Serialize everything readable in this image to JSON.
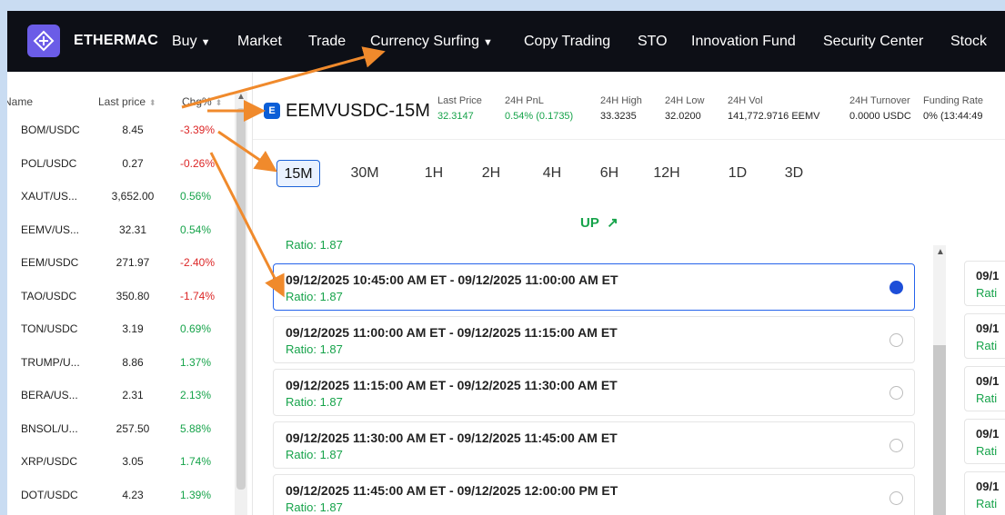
{
  "nav": {
    "brand": "ETHERMAC",
    "items": [
      "Buy",
      "Market",
      "Trade",
      "Currency Surfing",
      "Copy Trading",
      "STO",
      "Innovation Fund",
      "Security Center",
      "Stock"
    ]
  },
  "market": {
    "headers": {
      "name": "Name",
      "last_price": "Last price",
      "change": "Chg%"
    },
    "rows": [
      {
        "name": "BOM/USDC",
        "price": "8.45",
        "chg": "-3.39%"
      },
      {
        "name": "POL/USDC",
        "price": "0.27",
        "chg": "-0.26%"
      },
      {
        "name": "XAUT/US...",
        "price": "3,652.00",
        "chg": "0.56%"
      },
      {
        "name": "EEMV/US...",
        "price": "32.31",
        "chg": "0.54%"
      },
      {
        "name": "EEM/USDC",
        "price": "271.97",
        "chg": "-2.40%"
      },
      {
        "name": "TAO/USDC",
        "price": "350.80",
        "chg": "-1.74%"
      },
      {
        "name": "TON/USDC",
        "price": "3.19",
        "chg": "0.69%"
      },
      {
        "name": "TRUMP/U...",
        "price": "8.86",
        "chg": "1.37%"
      },
      {
        "name": "BERA/US...",
        "price": "2.31",
        "chg": "2.13%"
      },
      {
        "name": "BNSOL/U...",
        "price": "257.50",
        "chg": "5.88%"
      },
      {
        "name": "XRP/USDC",
        "price": "3.05",
        "chg": "1.74%"
      },
      {
        "name": "DOT/USDC",
        "price": "4.23",
        "chg": "1.39%"
      }
    ]
  },
  "ticker": {
    "icon_letter": "E",
    "symbol": "EEMVUSDC-15M",
    "stats": [
      {
        "label": "Last Price",
        "value": "32.3147",
        "green": true
      },
      {
        "label": "24H PnL",
        "value": "0.54% (0.1735)",
        "green": true
      },
      {
        "label": "24H High",
        "value": "33.3235",
        "green": false
      },
      {
        "label": "24H Low",
        "value": "32.0200",
        "green": false
      },
      {
        "label": "24H Vol",
        "value": "141,772.9716 EEMV",
        "green": false
      },
      {
        "label": "24H Turnover",
        "value": "0.0000 USDC",
        "green": false
      },
      {
        "label": "Funding Rate",
        "value": "0% (13:44:49",
        "green": false
      }
    ]
  },
  "intervals": {
    "items": [
      "15M",
      "30M",
      "1H",
      "2H",
      "4H",
      "6H",
      "12H",
      "1D",
      "3D"
    ],
    "active": "15M"
  },
  "options": {
    "direction_label": "UP",
    "direction_icon": "arrow-up-right-icon",
    "cut_ratio": "Ratio: 1.87",
    "cards": [
      {
        "time": "09/12/2025 10:45:00 AM ET - 09/12/2025 11:00:00 AM ET",
        "ratio": "Ratio: 1.87",
        "selected": true
      },
      {
        "time": "09/12/2025 11:00:00 AM ET - 09/12/2025 11:15:00 AM ET",
        "ratio": "Ratio: 1.87",
        "selected": false
      },
      {
        "time": "09/12/2025 11:15:00 AM ET - 09/12/2025 11:30:00 AM ET",
        "ratio": "Ratio: 1.87",
        "selected": false
      },
      {
        "time": "09/12/2025 11:30:00 AM ET - 09/12/2025 11:45:00 AM ET",
        "ratio": "Ratio: 1.87",
        "selected": false
      },
      {
        "time": "09/12/2025 11:45:00 AM ET - 09/12/2025 12:00:00 PM ET",
        "ratio": "Ratio: 1.87",
        "selected": false
      }
    ]
  },
  "right_cards": [
    {
      "time": "09/1",
      "ratio": "Rati"
    },
    {
      "time": "09/1",
      "ratio": "Rati"
    },
    {
      "time": "09/1",
      "ratio": "Rati"
    },
    {
      "time": "09/1",
      "ratio": "Rati"
    },
    {
      "time": "09/1",
      "ratio": "Rati"
    }
  ],
  "colors": {
    "nav_bg": "#0d0f16",
    "up_green": "#16a34a",
    "down_red": "#dc2626",
    "accent_blue": "#1d63d8",
    "annotation_orange": "#f08a2c",
    "page_bg": "#c9dcf2"
  }
}
